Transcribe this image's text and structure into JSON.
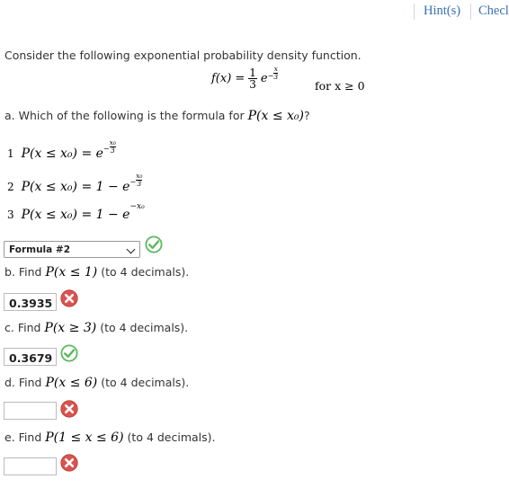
{
  "header": {
    "hints_label": "Hint(s)",
    "check_label": "Checl"
  },
  "intro": "Consider the following exponential probability density function.",
  "formula": {
    "lhs": "f(x) =",
    "coef_num": "1",
    "coef_den": "3",
    "base": "e",
    "exp_sign": "−",
    "exp_num": "x",
    "exp_den": "3",
    "condition": "for  x ≥ 0"
  },
  "part_a": {
    "prompt_prefix": "a. Which of the following is the formula for",
    "prompt_math": "P(x ≤ x₀)",
    "prompt_suffix": "?",
    "options": [
      {
        "num": "1",
        "lhs": "P(x ≤ x₀) = e",
        "exp_sign": "−",
        "exp_num": "x₀",
        "exp_den": "3"
      },
      {
        "num": "2",
        "lhs": "P(x ≤ x₀) = 1 − e",
        "exp_sign": "−",
        "exp_num": "x₀",
        "exp_den": "3"
      },
      {
        "num": "3",
        "lhs": "P(x ≤ x₀) = 1 − e",
        "exp": "−x₀"
      }
    ],
    "selected": "Formula #2",
    "status": "correct"
  },
  "part_b": {
    "prefix": "b. Find",
    "math": "P(x ≤ 1)",
    "suffix": "(to 4 decimals).",
    "answer": "0.3935",
    "status": "incorrect"
  },
  "part_c": {
    "prefix": "c. Find",
    "math": "P(x ≥ 3)",
    "suffix": "(to 4 decimals).",
    "answer": "0.3679",
    "status": "correct"
  },
  "part_d": {
    "prefix": "d. Find",
    "math": "P(x ≤ 6)",
    "suffix": "(to 4 decimals).",
    "answer": "",
    "status": "incorrect"
  },
  "part_e": {
    "prefix": "e. Find",
    "math": "P(1 ≤ x ≤ 6)",
    "suffix": "(to 4 decimals).",
    "answer": "",
    "status": "incorrect"
  },
  "colors": {
    "link": "#3b6fb3",
    "correct": "#5cb85c",
    "incorrect": "#d9534f"
  }
}
